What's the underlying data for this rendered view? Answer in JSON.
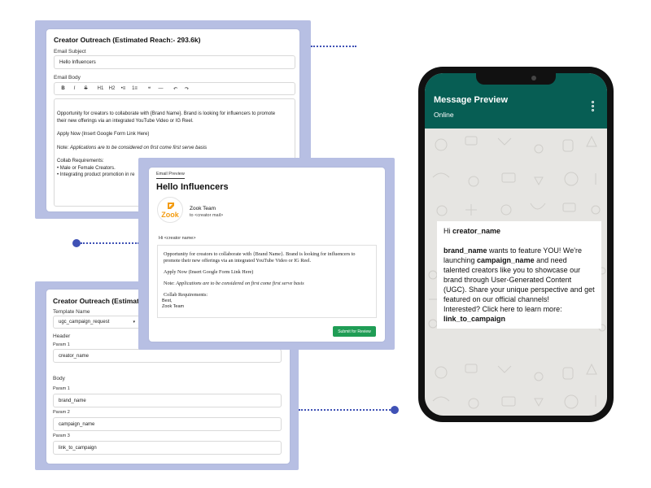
{
  "outreach_top": {
    "title": "Creator Outreach (Estimated Reach:- 293.6k)",
    "subject_label": "Email Subject",
    "subject_value": "Hello Influencers",
    "body_label": "Email Body",
    "toolbar": [
      "B",
      "I",
      "S",
      "H1",
      "H2",
      "•≡",
      "1≡",
      "❝",
      "—",
      "↶",
      "↷"
    ],
    "body_lines": [
      "Opportunity for creators to collaborate with {Brand Name}. Brand is looking for influencers to promote",
      "their new offerings via an integrated YouTube Video or IG Reel."
    ],
    "apply_line": "Apply Now (Insert Google Form Link Here)",
    "note_prefix": "Note: ",
    "note_italic": "Applications are to be considered on first come first serve basis",
    "collab_heading": "Collab Requirements:",
    "req1": "• Male or Female Creators.",
    "req2": "• Integrating product promotion in re"
  },
  "preview": {
    "tab": "Email Preview",
    "subject": "Hello Influencers",
    "logo_text": "Zook",
    "sender_name": "Zook Team",
    "sender_to": "to <creator mail>",
    "greeting": "Hi <creator name>",
    "body_line1": "Opportunity for creators to collaborate with {Brand Name}. Brand is looking for influencers to",
    "body_line2": "promote their new offerings via an integrated YouTube Video or IG Reel.",
    "apply_line": "Apply Now (Insert Google Form Link Here)",
    "note_prefix": "Note: ",
    "note_italic": "Applications are to be considered on first come first serve basis",
    "collab_heading": "Collab Requirements:",
    "sign_best": "Best,",
    "sign_team": "Zook Team",
    "submit_label": "Submit for Review"
  },
  "outreach_bottom": {
    "title": "Creator Outreach (Estimated Rea",
    "template_label": "Template Name",
    "template_value": "ugc_campaign_request",
    "header_label": "Header",
    "param1_label": "Param 1",
    "header_param1": "creator_name",
    "body_label": "Body",
    "body_param1_label": "Param 1",
    "body_param1": "brand_name",
    "body_param2_label": "Param 2",
    "body_param2": "campaign_name",
    "body_param3_label": "Param 3",
    "body_param3": "link_to_campaign"
  },
  "phone": {
    "title": "Message Preview",
    "status": "Online",
    "msg_hi": "Hi ",
    "msg_name": "creator_name",
    "msg_brand": "brand_name",
    "msg_t1": " wants to feature YOU! We're launching ",
    "msg_campaign": "campaign_name",
    "msg_t2": " and need talented creators like you to showcase our brand through User-Generated Content (UGC). Share your unique perspective and get featured on our official channels!",
    "msg_t3": "Interested? Click here to learn more:",
    "msg_link": "link_to_campaign",
    "header_color": "#075e54"
  },
  "colors": {
    "frame": "#b7bfe3",
    "connector": "#3f51b5",
    "submit": "#1f9d55",
    "logo_orange": "#f39c12"
  }
}
